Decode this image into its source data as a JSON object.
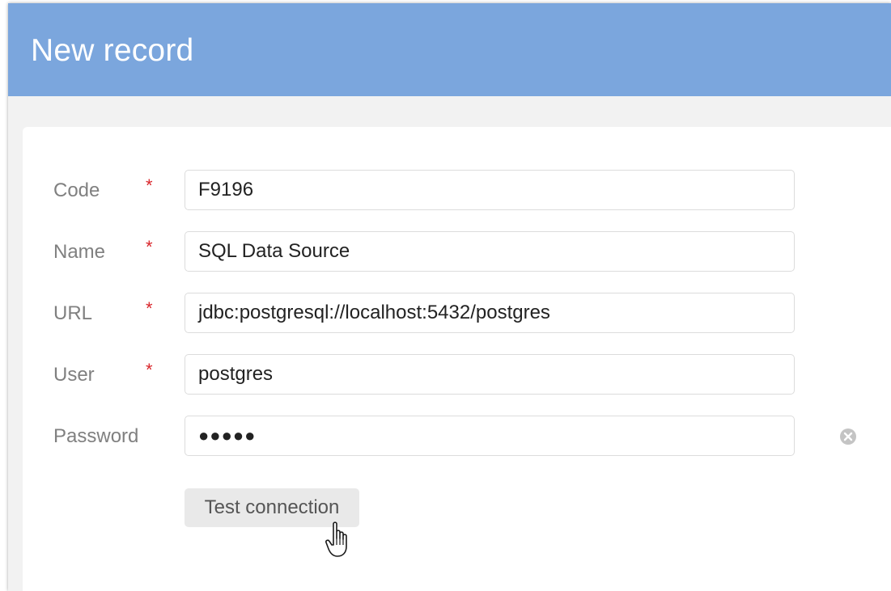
{
  "dialog": {
    "title": "New record"
  },
  "form": {
    "required_marker": "*",
    "fields": [
      {
        "label": "Code",
        "value": "F9196",
        "required": true
      },
      {
        "label": "Name",
        "value": "SQL Data Source",
        "required": true
      },
      {
        "label": "URL",
        "value": "jdbc:postgresql://localhost:5432/postgres",
        "required": true
      },
      {
        "label": "User",
        "value": "postgres",
        "required": true
      },
      {
        "label": "Password",
        "value": "●●●●●",
        "required": false
      }
    ],
    "clear_icon": "clear-circle-icon",
    "test_button_label": "Test connection"
  },
  "cursor": {
    "icon": "hand-pointer-icon"
  },
  "colors": {
    "header": "#7ba6dd",
    "required": "#d9262b",
    "label": "#808080"
  }
}
